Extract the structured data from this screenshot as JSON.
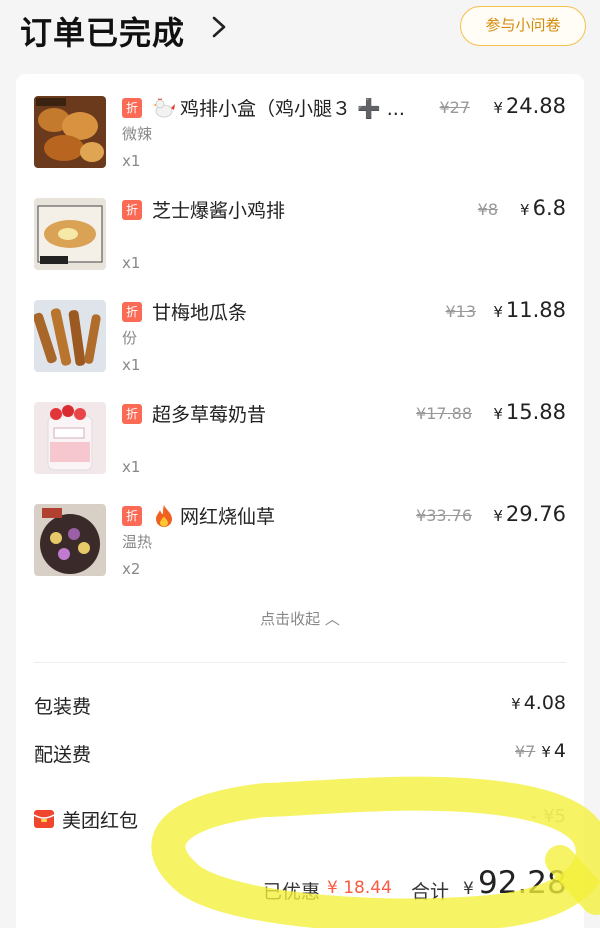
{
  "header": {
    "title": "订单已完成",
    "survey_label": "参与小问卷"
  },
  "items": [
    {
      "emoji": "rooster-icon",
      "name": "鸡排小盒（鸡小腿３ ➕ ...",
      "spec": "微辣",
      "qty": "x1",
      "orig_price": "¥27",
      "price": "24.88"
    },
    {
      "emoji": "",
      "name": "芝士爆酱小鸡排",
      "spec": "",
      "qty": "x1",
      "orig_price": "¥8",
      "price": "6.8"
    },
    {
      "emoji": "",
      "name": "甘梅地瓜条",
      "spec": "份",
      "qty": "x1",
      "orig_price": "¥13",
      "price": "11.88"
    },
    {
      "emoji": "",
      "name": "超多草莓奶昔",
      "spec": "",
      "qty": "x1",
      "orig_price": "¥17.88",
      "price": "15.88"
    },
    {
      "emoji": "fire-icon",
      "name": "网红烧仙草",
      "spec": "温热",
      "qty": "x2",
      "orig_price": "¥33.76",
      "price": "29.76"
    }
  ],
  "discount_badge": "折",
  "currency": "¥",
  "collapse_label": "点击收起 ︿",
  "fees": {
    "packaging_label": "包装费",
    "packaging_value": "4.08",
    "delivery_label": "配送费",
    "delivery_orig": "¥7",
    "delivery_value": "4"
  },
  "red_packet": {
    "label": "美团红包",
    "value": "- ¥5"
  },
  "summary": {
    "saved_label": "已优惠",
    "saved_value": "¥ 18.44",
    "total_label": "合计",
    "total_value": "92.28"
  },
  "colors": {
    "accent_orange": "#d6890a",
    "discount_red": "#fb6a55",
    "highlight_yellow": "#f4f03a"
  }
}
